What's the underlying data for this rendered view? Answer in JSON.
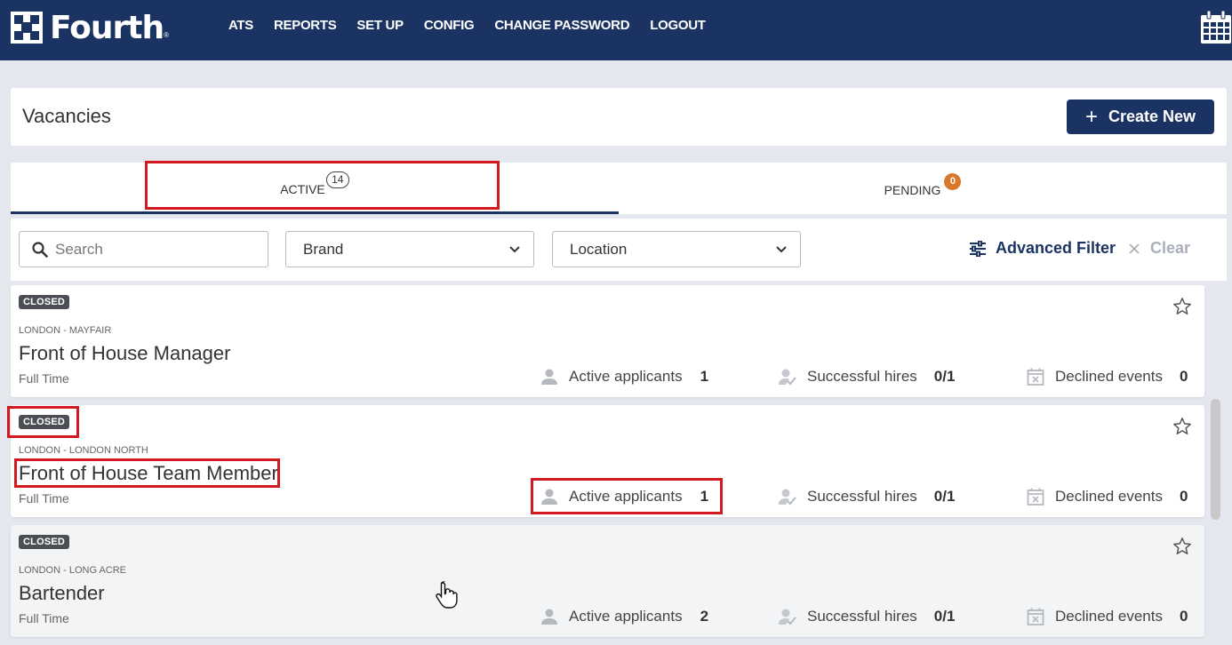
{
  "brand": {
    "name": "Fourth"
  },
  "nav": {
    "items": [
      "ATS",
      "REPORTS",
      "SET UP",
      "CONFIG",
      "CHANGE PASSWORD",
      "LOGOUT"
    ]
  },
  "header": {
    "title": "Vacancies",
    "create_label": "Create New"
  },
  "tabs": {
    "active": {
      "label": "ACTIVE",
      "count": "14"
    },
    "pending": {
      "label": "PENDING",
      "count": "0"
    }
  },
  "filters": {
    "search_placeholder": "Search",
    "brand_label": "Brand",
    "location_label": "Location",
    "advanced_label": "Advanced Filter",
    "clear_label": "Clear"
  },
  "stat_labels": {
    "active": "Active applicants",
    "hires": "Successful hires",
    "declined": "Declined events"
  },
  "vacancies": [
    {
      "status": "CLOSED",
      "location": "LONDON - MAYFAIR",
      "title": "Front of House Manager",
      "type": "Full Time",
      "active": "1",
      "hires": "0/1",
      "declined": "0"
    },
    {
      "status": "CLOSED",
      "location": "LONDON - LONDON NORTH",
      "title": "Front of House Team Member",
      "type": "Full Time",
      "active": "1",
      "hires": "0/1",
      "declined": "0"
    },
    {
      "status": "CLOSED",
      "location": "LONDON - LONG ACRE",
      "title": "Bartender",
      "type": "Full Time",
      "active": "2",
      "hires": "0/1",
      "declined": "0"
    }
  ],
  "colors": {
    "navy": "#1b3363",
    "accent_orange": "#d9772b",
    "highlight_red": "#d4181f"
  }
}
